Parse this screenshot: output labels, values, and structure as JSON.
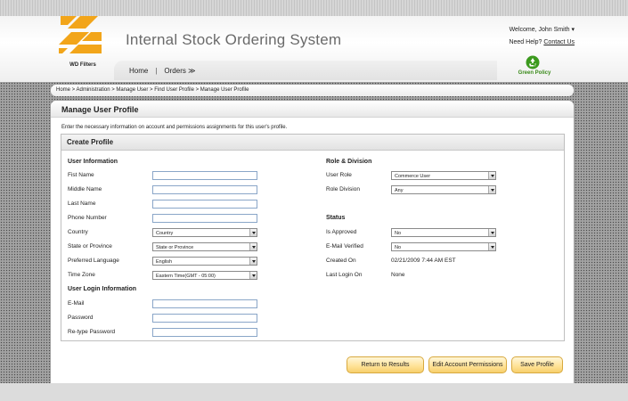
{
  "header": {
    "logo_text": "WD Filters",
    "app_title": "Internal Stock Ordering System",
    "welcome": "Welcome, John Smith ▾",
    "help_prefix": "Need Help?",
    "help_link": "Contact Us",
    "green_policy": "Green Policy",
    "nav": {
      "home": "Home",
      "separator": "|",
      "orders": "Orders ≫"
    },
    "brand_color": "#f2a51a"
  },
  "breadcrumb": "Home > Administration > Manage User > Find User Profile > Manage User Profile",
  "page": {
    "title": "Manage User Profile",
    "intro": "Enter the necessary information on account and permissions assignments for this user's profile.",
    "box_title": "Create Profile"
  },
  "user_info": {
    "heading": "User Information",
    "first_name": {
      "label": "Fist Name",
      "value": ""
    },
    "middle_name": {
      "label": "Middle Name",
      "value": ""
    },
    "last_name": {
      "label": "Last Name",
      "value": ""
    },
    "phone": {
      "label": "Phone Number",
      "value": ""
    },
    "country": {
      "label": "Country",
      "selected": "Country"
    },
    "state": {
      "label": "State or Province",
      "selected": "State or Province"
    },
    "language": {
      "label": "Preferred Language",
      "selected": "English"
    },
    "timezone": {
      "label": "Time Zone",
      "selected": "Eastern Time(GMT - 05:00)"
    }
  },
  "login_info": {
    "heading": "User Login Information",
    "email": {
      "label": "E-Mail",
      "value": ""
    },
    "password": {
      "label": "Password",
      "value": ""
    },
    "retype": {
      "label": "Re-type Password",
      "value": ""
    }
  },
  "role": {
    "heading": "Role & Division",
    "user_role": {
      "label": "User Role",
      "selected": "Commerce User"
    },
    "division": {
      "label": "Role Division",
      "selected": "Any"
    }
  },
  "status": {
    "heading": "Status",
    "approved": {
      "label": "Is Approved",
      "selected": "No"
    },
    "verified": {
      "label": "E-Mail Verified",
      "selected": "No"
    },
    "created": {
      "label": "Created On",
      "value": "02/21/2009 7:44 AM EST"
    },
    "last_login": {
      "label": "Last Login On",
      "value": "None"
    }
  },
  "buttons": {
    "return": "Return to Results",
    "permissions": "Edit Account Permissions",
    "save": "Save Profile"
  }
}
